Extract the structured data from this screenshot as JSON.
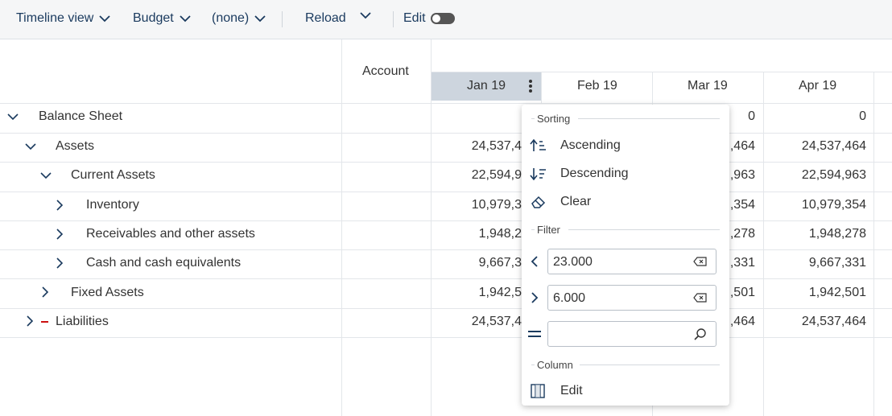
{
  "toolbar": {
    "timeline_label": "Timeline view",
    "budget_label": "Budget",
    "none_label": "(none)",
    "reload_label": "Reload",
    "edit_label": "Edit"
  },
  "grid": {
    "account_header": "Account",
    "columns": [
      "Jan 19",
      "Feb 19",
      "Mar 19",
      "Apr 19"
    ],
    "rows": [
      {
        "label": "Balance Sheet",
        "jan": "",
        "mar": "0",
        "apr": "0"
      },
      {
        "label": "Assets",
        "jan": "24,537,4",
        "mar": ",464",
        "apr": "24,537,464"
      },
      {
        "label": "Current Assets",
        "jan": "22,594,9",
        "mar": ",963",
        "apr": "22,594,963"
      },
      {
        "label": "Inventory",
        "jan": "10,979,3",
        "mar": ",354",
        "apr": "10,979,354"
      },
      {
        "label": "Receivables and other assets",
        "jan": "1,948,2",
        "mar": ",278",
        "apr": "1,948,278"
      },
      {
        "label": "Cash and cash equivalents",
        "jan": "9,667,3",
        "mar": ",331",
        "apr": "9,667,331"
      },
      {
        "label": "Fixed Assets",
        "jan": "1,942,5",
        "mar": ",501",
        "apr": "1,942,501"
      },
      {
        "label": "Liabilities",
        "jan": "24,537,4",
        "mar": ",464",
        "apr": "24,537,464"
      }
    ]
  },
  "menu": {
    "sorting_title": "Sorting",
    "ascending": "Ascending",
    "descending": "Descending",
    "clear": "Clear",
    "filter_title": "Filter",
    "less_than_value": "23.000",
    "greater_than_value": "6.000",
    "equals_value": "",
    "column_title": "Column",
    "edit": "Edit"
  },
  "colors": {
    "accent": "#1a3a5e",
    "selected_header_bg": "#cdd5de",
    "toolbar_bg": "#f5f6f7",
    "liabilities_marker": "#cc1111"
  }
}
